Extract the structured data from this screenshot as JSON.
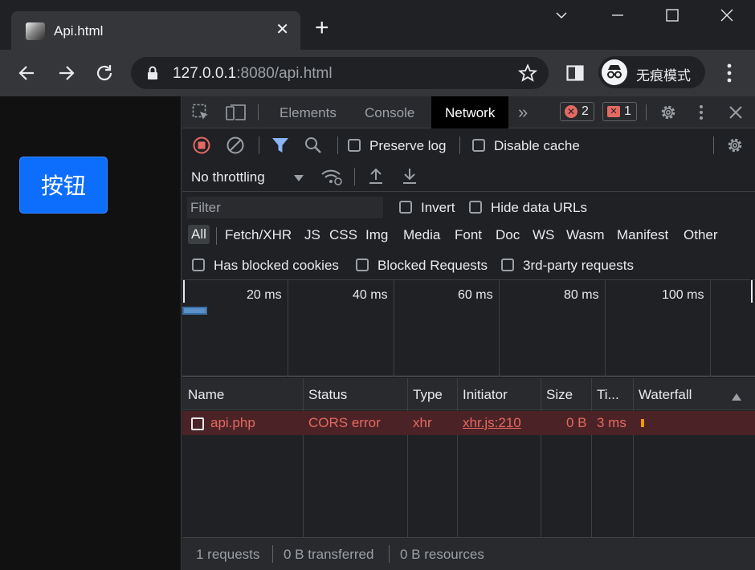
{
  "browser": {
    "tab_title": "Api.html",
    "tab_close": "✕",
    "new_tab": "+",
    "url_host": "127.0.0.1",
    "url_rest": ":8080/api.html",
    "incognito_label": "无痕模式",
    "window_controls": [
      "chevron-down-icon",
      "minimize-icon",
      "maximize-icon",
      "close-icon"
    ]
  },
  "page": {
    "button_label": "按钮",
    "button_color": "#0d6efd"
  },
  "devtools": {
    "tabs": [
      "Elements",
      "Console",
      "Network"
    ],
    "active_tab": "Network",
    "more_tabs": "»",
    "error_count": "2",
    "issue_count": "1",
    "preserve_log": "Preserve log",
    "disable_cache": "Disable cache",
    "throttling": "No throttling",
    "filter_placeholder": "Filter",
    "invert": "Invert",
    "hide_data_urls": "Hide data URLs",
    "type_filters": [
      "All",
      "Fetch/XHR",
      "JS",
      "CSS",
      "Img",
      "Media",
      "Font",
      "Doc",
      "WS",
      "Wasm",
      "Manifest",
      "Other"
    ],
    "has_blocked_cookies": "Has blocked cookies",
    "blocked_requests": "Blocked Requests",
    "third_party": "3rd-party requests",
    "timeline_ticks": [
      "20 ms",
      "40 ms",
      "60 ms",
      "80 ms",
      "100 ms"
    ],
    "columns": [
      "Name",
      "Status",
      "Type",
      "Initiator",
      "Size",
      "Ti...",
      "Waterfall"
    ],
    "requests": [
      {
        "name": "api.php",
        "status": "CORS error",
        "type": "xhr",
        "initiator": "xhr.js:210",
        "size": "0 B",
        "time": "3 ms"
      }
    ],
    "status_requests": "1 requests",
    "status_transferred": "0 B transferred",
    "status_resources": "0 B resources",
    "error_color": "#e46962"
  }
}
